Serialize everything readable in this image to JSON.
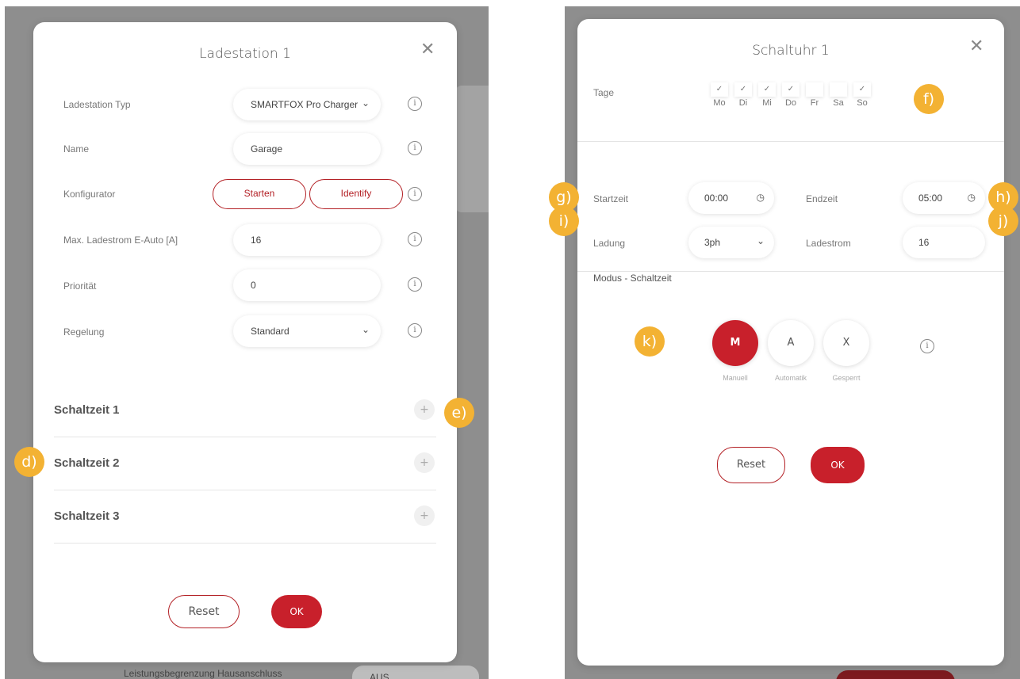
{
  "left_modal": {
    "title": "Ladestation 1",
    "close_icon": "close-icon",
    "rows": [
      {
        "label": "Ladestation Typ",
        "value": "SMARTFOX Pro Charger",
        "dropdown": true
      },
      {
        "label": "Name",
        "value": "Garage"
      },
      {
        "label": "Konfigurator"
      },
      {
        "label": "Max. Ladestrom E-Auto [A]",
        "value": "16"
      },
      {
        "label": "Priorität",
        "value": "0"
      },
      {
        "label": "Regelung",
        "value": "Standard",
        "dropdown": true
      }
    ],
    "konfigurator_buttons": {
      "start": "Starten",
      "identify": "Identify"
    },
    "sections": [
      "Schaltzeit 1",
      "Schaltzeit 2",
      "Schaltzeit 3"
    ],
    "reset_label": "Reset",
    "ok_label": "OK"
  },
  "background": {
    "footer_label": "Leistungsbegrenzung Hausanschluss",
    "footer_value": "AUS"
  },
  "right_modal": {
    "title": "Schaltuhr 1",
    "days_label": "Tage",
    "days": [
      {
        "label": "Mo",
        "checked": true
      },
      {
        "label": "Di",
        "checked": true
      },
      {
        "label": "Mi",
        "checked": true
      },
      {
        "label": "Do",
        "checked": true
      },
      {
        "label": "Fr",
        "checked": false
      },
      {
        "label": "Sa",
        "checked": false
      },
      {
        "label": "So",
        "checked": true
      }
    ],
    "start_label": "Startzeit",
    "start_value": "00:00",
    "end_label": "Endzeit",
    "end_value": "05:00",
    "charge_label": "Ladung",
    "charge_value": "3ph",
    "current_label": "Ladestrom",
    "current_value": "16",
    "mode_title": "Modus - Schaltzeit",
    "modes": [
      {
        "key": "M",
        "label": "Manuell",
        "active": true
      },
      {
        "key": "A",
        "label": "Automatik",
        "active": false
      },
      {
        "key": "X",
        "label": "Gesperrt",
        "active": false
      }
    ],
    "reset_label": "Reset",
    "ok_label": "OK"
  },
  "badges": {
    "d": "d)",
    "e": "e)",
    "f": "f)",
    "g": "g)",
    "h": "h)",
    "i": "i)",
    "j": "j)",
    "k": "k)"
  },
  "colors": {
    "accent": "#c8202b",
    "badge": "#f3b233"
  }
}
